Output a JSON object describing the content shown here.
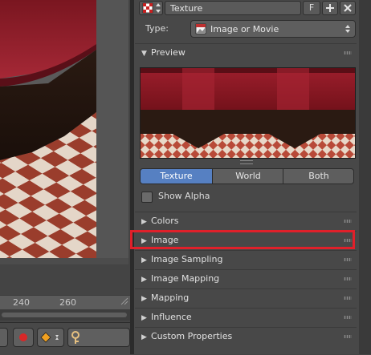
{
  "timeline": {
    "ruler_marks": [
      "240",
      "260"
    ]
  },
  "header": {
    "texture_name": "Texture",
    "fake_user_label": "F",
    "icons": [
      "checker-icon",
      "updown-arrows-icon",
      "plus-icon",
      "close-icon"
    ]
  },
  "type_row": {
    "label": "Type:",
    "value": "Image or Movie"
  },
  "preview": {
    "title": "Preview",
    "tabs": [
      "Texture",
      "World",
      "Both"
    ],
    "active_tab": "Texture",
    "show_alpha_label": "Show Alpha",
    "show_alpha_checked": false
  },
  "sections": [
    {
      "label": "Colors",
      "expanded": false
    },
    {
      "label": "Image",
      "expanded": false,
      "highlighted": true
    },
    {
      "label": "Image Sampling",
      "expanded": false
    },
    {
      "label": "Image Mapping",
      "expanded": false
    },
    {
      "label": "Mapping",
      "expanded": false
    },
    {
      "label": "Influence",
      "expanded": false
    },
    {
      "label": "Custom Properties",
      "expanded": false
    }
  ],
  "colors": {
    "panel_bg": "#484848",
    "active_tab": "#5680c2",
    "highlight_border": "#e0202a"
  }
}
